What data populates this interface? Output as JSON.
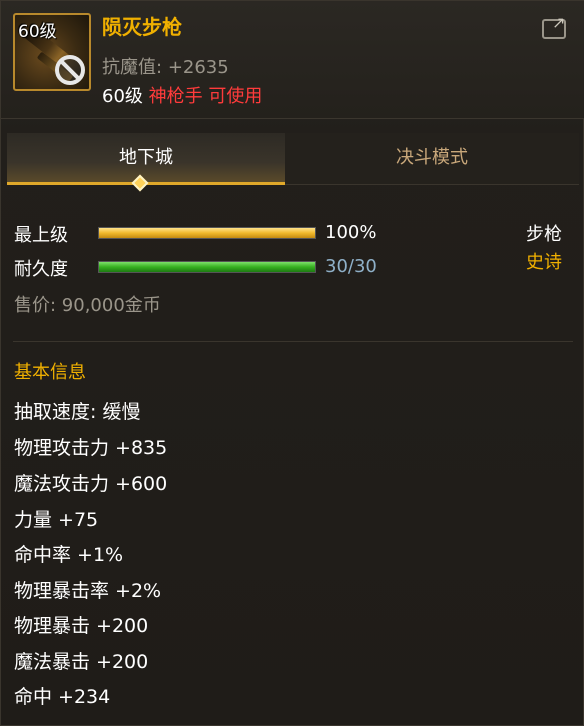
{
  "item": {
    "level_tag": "60级",
    "name": "陨灭步枪",
    "resist_label": "抗魔值:",
    "resist_value": "+2635",
    "req_level": "60级",
    "req_class": "神枪手 可使用",
    "icon": "rifle-icon",
    "status_icon": "forbidden-icon"
  },
  "header": {
    "share_icon": "share-icon"
  },
  "tabs": [
    {
      "label": "地下城",
      "active": true
    },
    {
      "label": "决斗模式",
      "active": false
    }
  ],
  "stats": {
    "level_label": "最上级",
    "level_value": "100%",
    "level_progress": 1.0,
    "durability_label": "耐久度",
    "durability_value": "30/30",
    "durability_progress": 1.0,
    "type": "步枪",
    "rarity": "史诗",
    "price": "售价: 90,000金币"
  },
  "info": {
    "title": "基本信息",
    "attrs": [
      "抽取速度: 缓慢",
      "物理攻击力 +835",
      "魔法攻击力 +600",
      "力量 +75",
      "命中率 +1%",
      "物理暴击率 +2%",
      "物理暴击 +200",
      "魔法暴击 +200",
      "命中 +234"
    ]
  },
  "colors": {
    "gold": "#f0b000",
    "red": "#ff3b3b",
    "durability_text": "#8fb0c8",
    "rarity": "#f0b000"
  }
}
